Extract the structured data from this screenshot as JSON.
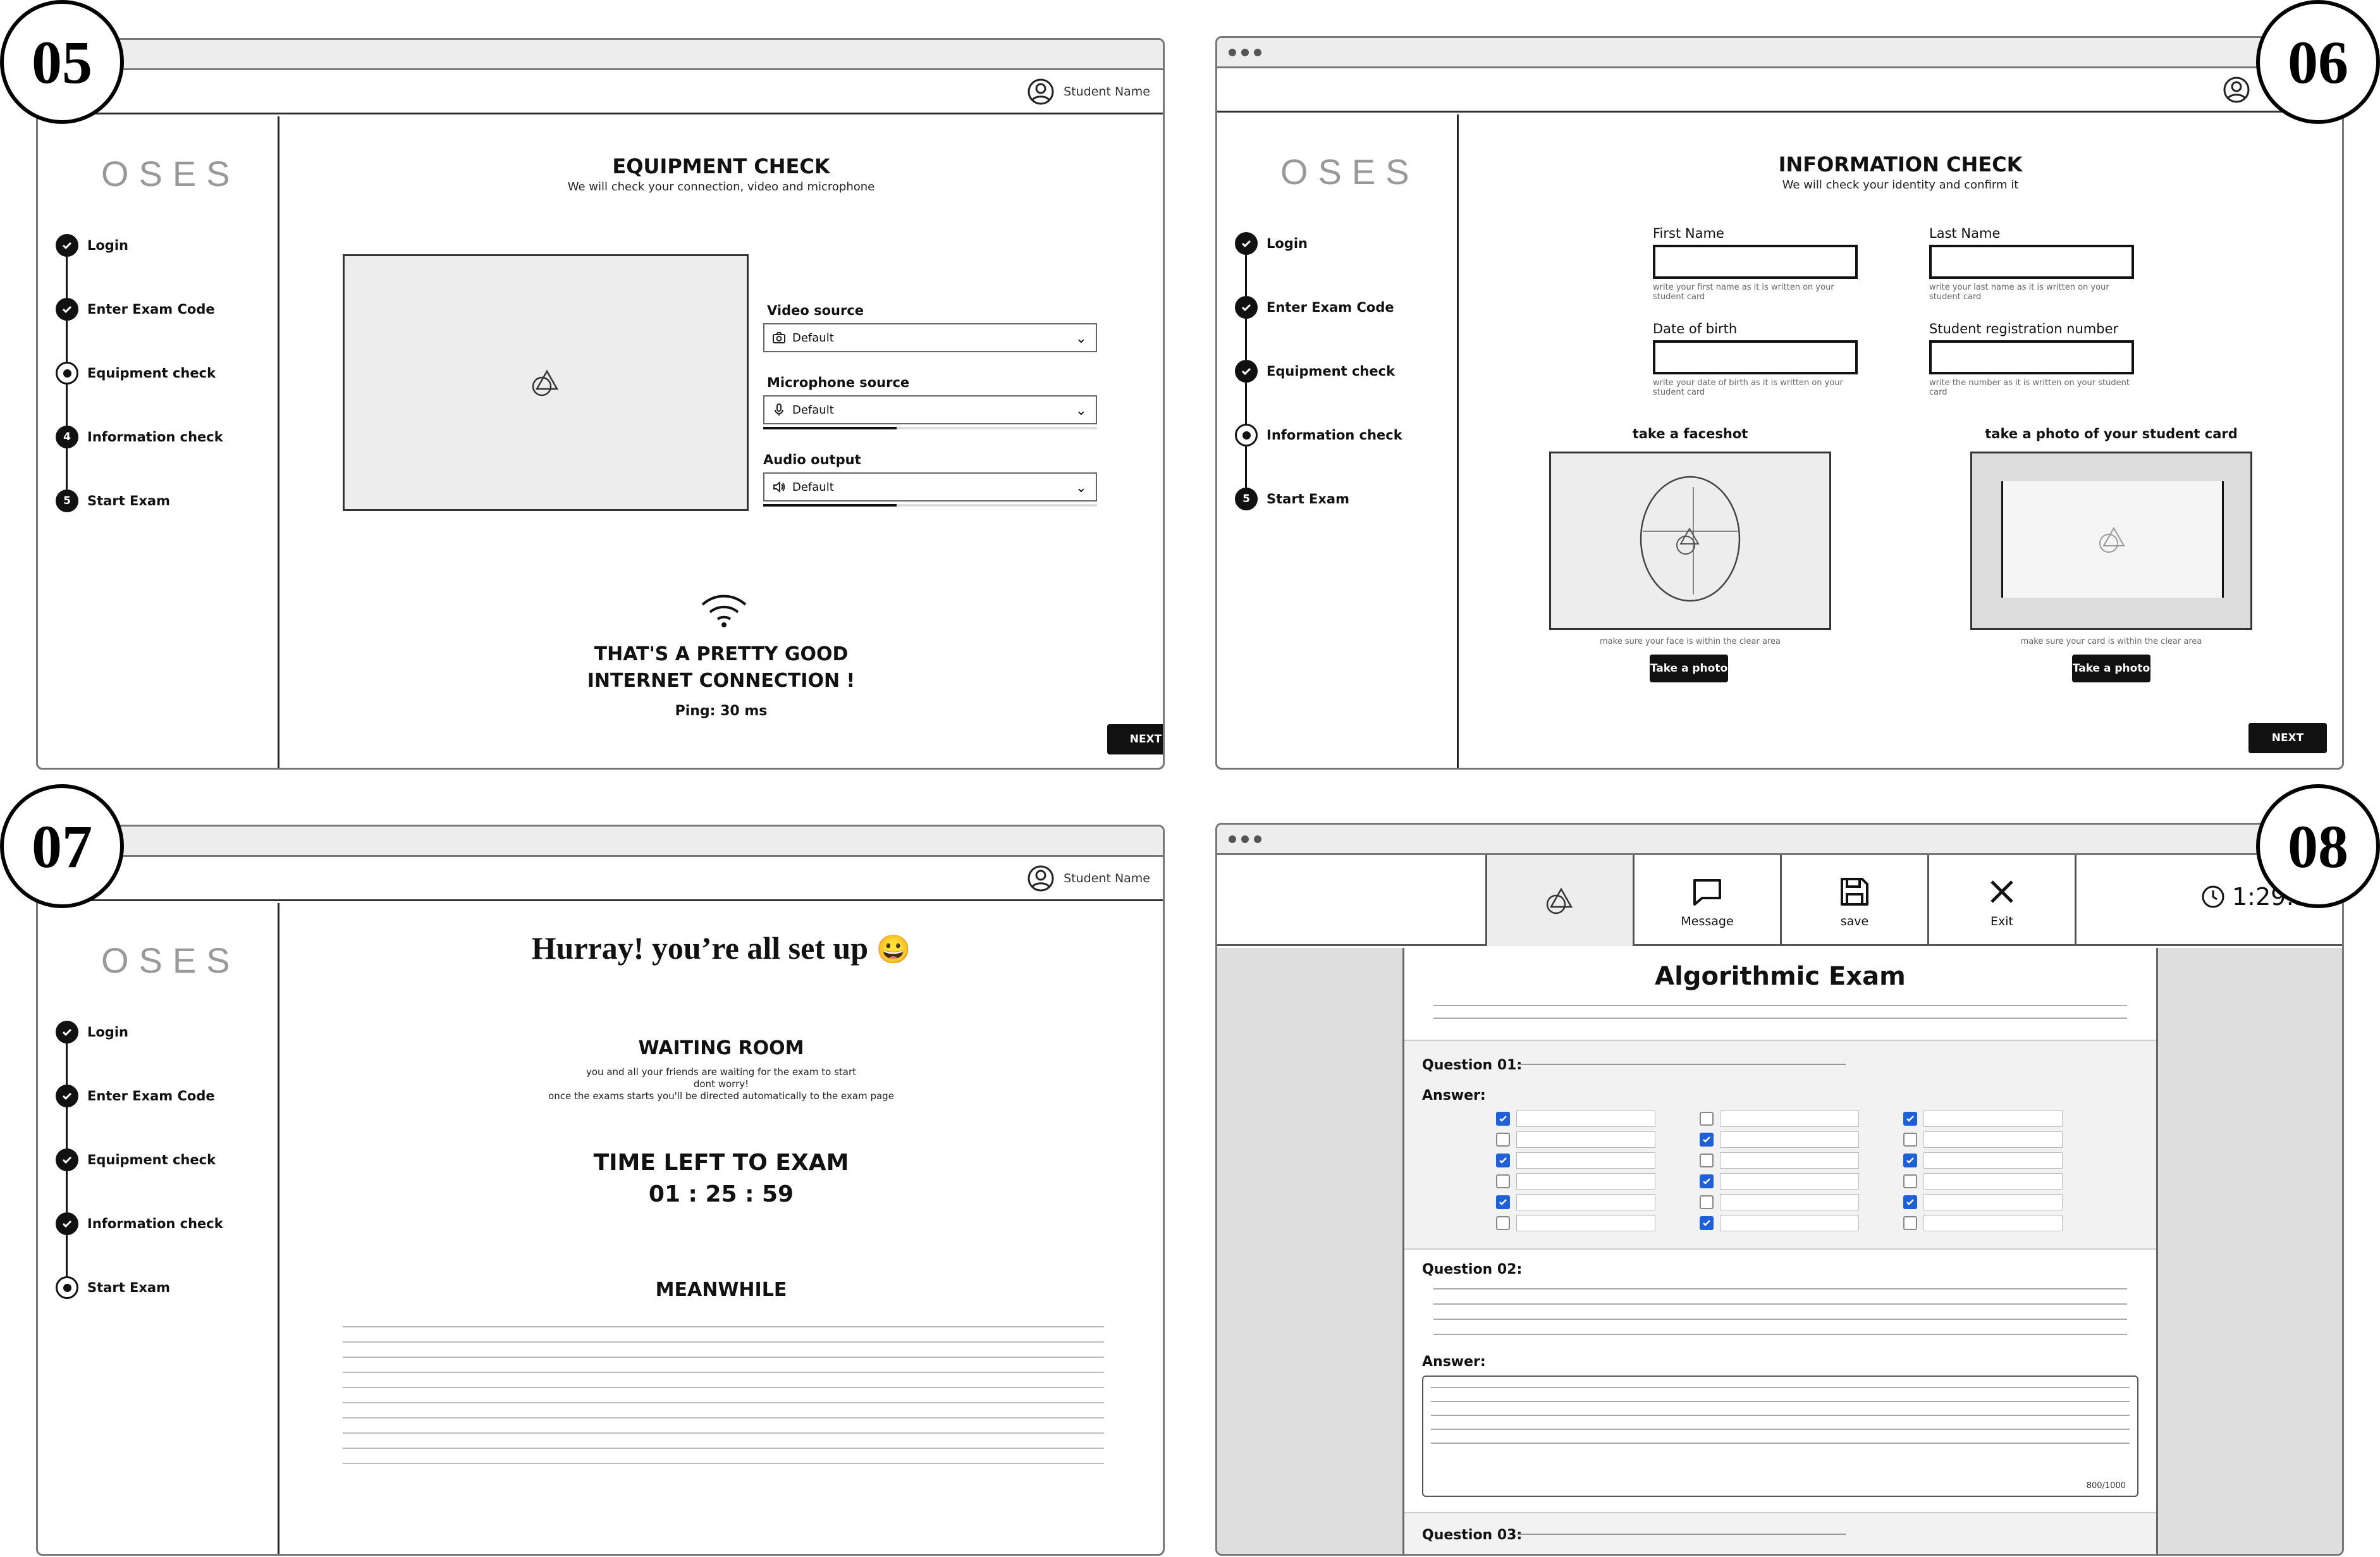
{
  "badges": {
    "s05": "05",
    "s06": "06",
    "s07": "07",
    "s08": "08"
  },
  "common": {
    "logo": "OSES",
    "user_name": "Student Name",
    "steps": [
      "Login",
      "Enter Exam Code",
      "Equipment check",
      "Information check",
      "Start Exam"
    ],
    "step_num_4": "4",
    "step_num_5": "5",
    "next": "NEXT"
  },
  "equipment": {
    "title": "EQUIPMENT CHECK",
    "subtitle": "We will check your connection, video and microphone",
    "video_label": "Video source",
    "video_value": "Default",
    "mic_label": "Microphone source",
    "mic_value": "Default",
    "mic_level": 0.4,
    "audio_label": "Audio output",
    "audio_value": "Default",
    "audio_level": 0.4,
    "connection_line1": "THAT'S A PRETTY GOOD",
    "connection_line2": "INTERNET CONNECTION !",
    "ping": "Ping: 30 ms"
  },
  "information": {
    "title": "INFORMATION CHECK",
    "subtitle": "We will check your identity and confirm it",
    "first_name_label": "First Name",
    "first_name_hint": "write your first name as it is written on your student card",
    "last_name_label": "Last Name",
    "last_name_hint": "write your last name as it is written on your student card",
    "dob_label": "Date of birth",
    "dob_hint": "write your date of birth as it is written on your student card",
    "reg_label": "Student registration number",
    "reg_hint": "write the number as it is written on your student card",
    "faceshot_title": "take a faceshot",
    "faceshot_hint": "make sure your face is within the clear area",
    "card_title": "take a photo of your student card",
    "card_hint": "make sure your card is within the clear area",
    "take_photo": "Take a photo"
  },
  "waiting": {
    "hurray": "Hurray! you’re all set up",
    "emoji": "😀",
    "room_title": "WAITING ROOM",
    "room_line1": "you and all your friends are waiting for the exam to start",
    "room_line2": "dont worry!",
    "room_line3": "once the exams starts you'll be directed automatically to the exam page",
    "time_title": "TIME LEFT TO EXAM",
    "time_value": "01 : 25 : 59",
    "meanwhile": "MEANWHILE"
  },
  "exam": {
    "message": "Message",
    "save": "save",
    "exit": "Exit",
    "timer": "1:29:59",
    "title": "Algorithmic Exam",
    "q1": "Question 01:",
    "answer": "Answer:",
    "q2": "Question 02:",
    "counter": "800/1000",
    "q3": "Question 03:",
    "checks": [
      [
        true,
        false,
        true
      ],
      [
        false,
        true,
        false
      ],
      [
        true,
        false,
        true
      ],
      [
        false,
        true,
        false
      ],
      [
        true,
        false,
        true
      ],
      [
        false,
        true,
        false
      ]
    ]
  },
  "icons": [
    "user-icon",
    "check-icon",
    "camera-icon",
    "microphone-icon",
    "speaker-icon",
    "chevron-down-icon",
    "wifi-icon",
    "image-placeholder-icon",
    "message-icon",
    "save-icon",
    "close-icon",
    "clock-icon"
  ]
}
